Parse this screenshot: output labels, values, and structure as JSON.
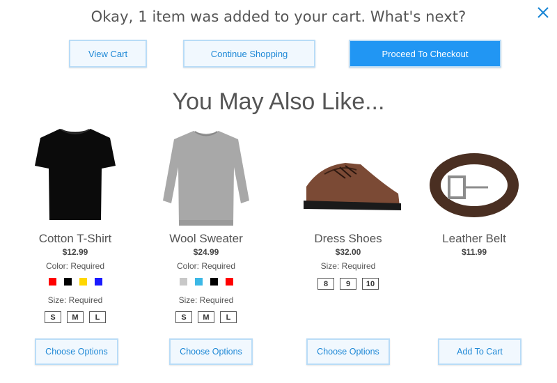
{
  "header": {
    "title": "Okay, 1 item was added to your cart. What's next?"
  },
  "actions": {
    "view_cart": "View Cart",
    "continue_shopping": "Continue Shopping",
    "proceed_checkout": "Proceed To Checkout"
  },
  "section_title": "You May Also Like...",
  "colors": {
    "accent": "#2196f3",
    "accent_light": "#f1f8fe",
    "accent_border": "#b9dcf7"
  },
  "products": [
    {
      "name": "Cotton T-Shirt",
      "price": "$12.99",
      "color_label": "Color: Required",
      "swatches": [
        "#ff0000",
        "#000000",
        "#ffd700",
        "#1a1aff"
      ],
      "size_label": "Size: Required",
      "sizes": [
        "S",
        "M",
        "L"
      ],
      "button": "Choose Options"
    },
    {
      "name": "Wool Sweater",
      "price": "$24.99",
      "color_label": "Color: Required",
      "swatches": [
        "#c8c8c8",
        "#3cb8e6",
        "#000000",
        "#ff0000"
      ],
      "size_label": "Size: Required",
      "sizes": [
        "S",
        "M",
        "L"
      ],
      "button": "Choose Options"
    },
    {
      "name": "Dress Shoes",
      "price": "$32.00",
      "size_label": "Size: Required",
      "sizes": [
        "8",
        "9",
        "10"
      ],
      "button": "Choose Options"
    },
    {
      "name": "Leather Belt",
      "price": "$11.99",
      "button": "Add To Cart"
    }
  ]
}
